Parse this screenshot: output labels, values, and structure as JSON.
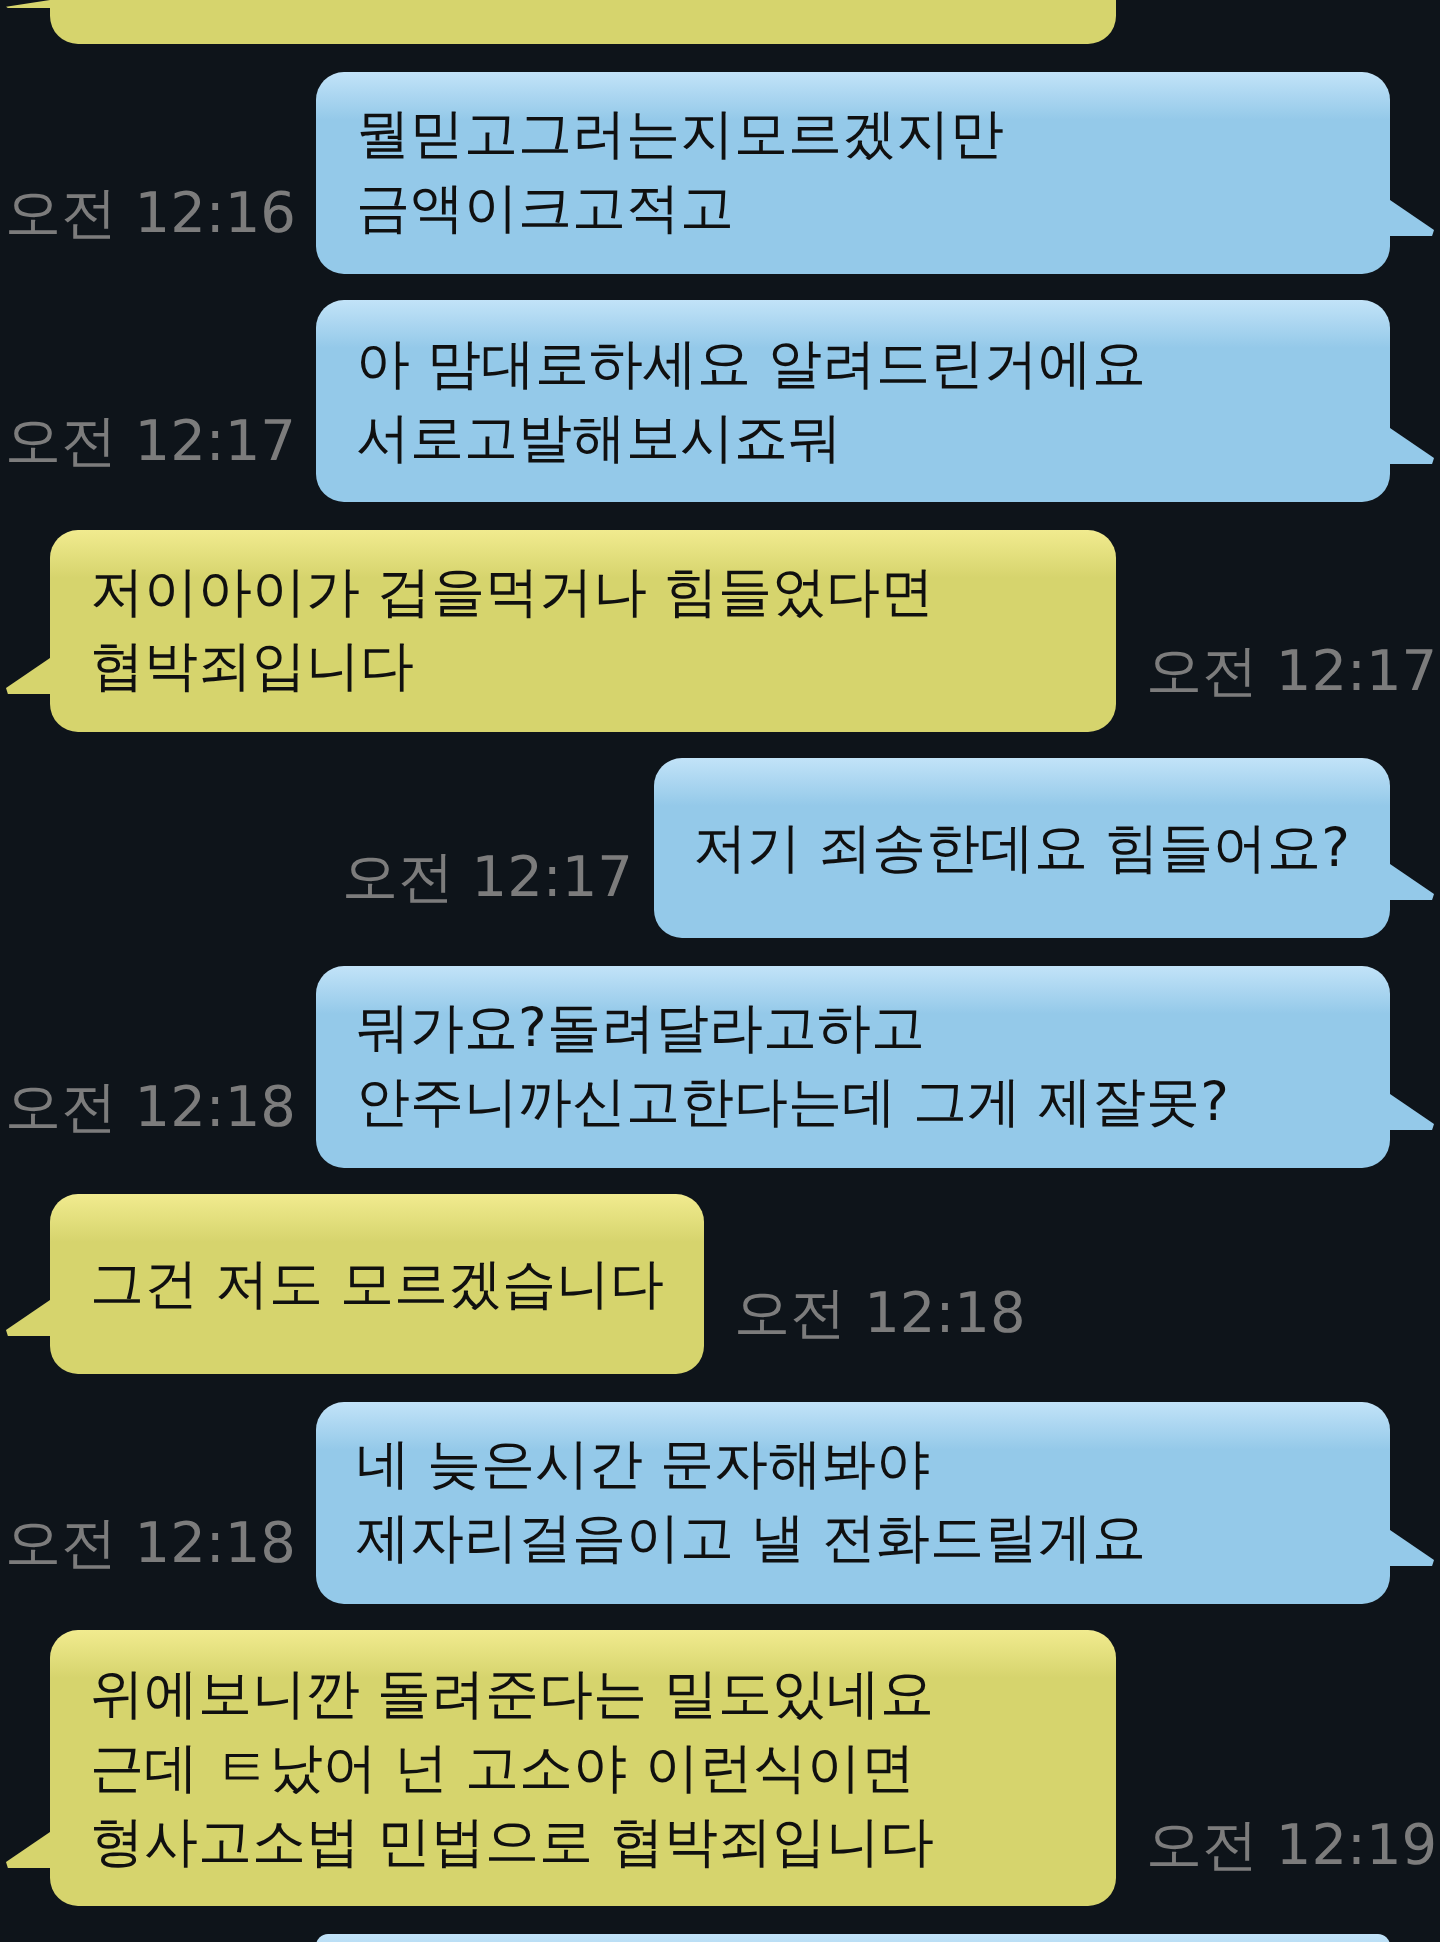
{
  "top_cut_bubble": {
    "kind": "received"
  },
  "messages": [
    {
      "kind": "sent",
      "time": "오전 12:16",
      "lines": [
        "뭘믿고그러는지모르겠지만",
        "금액이크고적고"
      ]
    },
    {
      "kind": "sent",
      "time": "오전 12:17",
      "lines": [
        "아 맘대로하세요 알려드린거에요",
        "서로고발해보시죠뭐"
      ]
    },
    {
      "kind": "received",
      "time": "오전 12:17",
      "lines": [
        "저이아이가 겁을먹거나 힘들었다면",
        "협박죄입니다"
      ]
    },
    {
      "kind": "sent",
      "time": "오전 12:17",
      "lines": [
        "저기 죄송한데요 힘들어요?"
      ]
    },
    {
      "kind": "sent",
      "time": "오전 12:18",
      "lines": [
        "뭐가요?돌려달라고하고",
        "안주니까신고한다는데 그게 제잘못?"
      ]
    },
    {
      "kind": "received",
      "time": "오전 12:18",
      "lines": [
        "그건 저도 모르겠습니다"
      ]
    },
    {
      "kind": "sent",
      "time": "오전 12:18",
      "lines": [
        "네 늦은시간 문자해봐야",
        "제자리걸음이고 낼 전화드릴게요"
      ]
    },
    {
      "kind": "received",
      "time": "오전 12:19",
      "lines": [
        "위에보니깐 돌려준다는 밀도있네요",
        "근데 ㅌ났어 넌 고소야 이런식이면",
        "형사고소법 민법으로 협박죄입니다"
      ]
    }
  ],
  "bottom_cut_bubble": {
    "kind": "sent"
  }
}
